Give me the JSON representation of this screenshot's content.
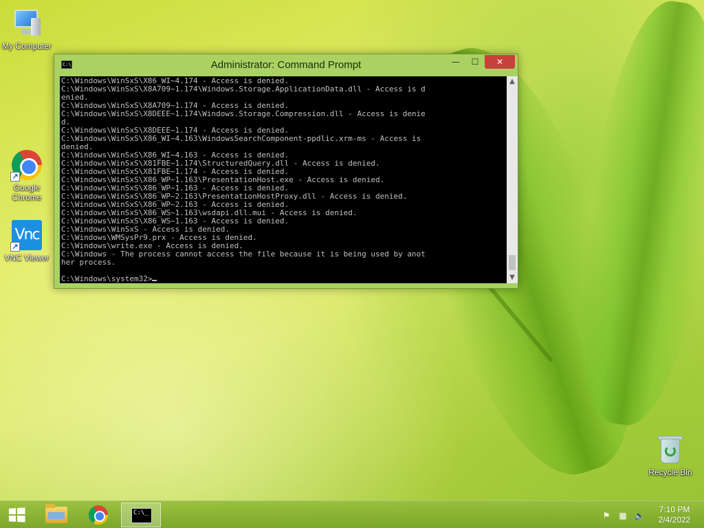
{
  "desktop": {
    "icons": [
      {
        "label": "My Computer"
      },
      {
        "label": "Google Chrome"
      },
      {
        "label": "VNC Viewer"
      },
      {
        "label": "Recycle Bin"
      }
    ],
    "vnc_glyph": "Vnc",
    "shortcut_glyph": "↗"
  },
  "window": {
    "title": "Administrator: Command Prompt",
    "icon_text": "C:\\",
    "minimize_glyph": "—",
    "maximize_glyph": "☐",
    "close_glyph": "✕"
  },
  "console": {
    "lines": [
      "C:\\Windows\\WinSxS\\X86_WI~4.174 - Access is denied.",
      "C:\\Windows\\WinSxS\\X8A709~1.174\\Windows.Storage.ApplicationData.dll - Access is d",
      "enied.",
      "C:\\Windows\\WinSxS\\X8A709~1.174 - Access is denied.",
      "C:\\Windows\\WinSxS\\X8DEEE~1.174\\Windows.Storage.Compression.dll - Access is denie",
      "d.",
      "C:\\Windows\\WinSxS\\X8DEEE~1.174 - Access is denied.",
      "C:\\Windows\\WinSxS\\X86_WI~4.163\\WindowsSearchComponent-ppdlic.xrm-ms - Access is",
      "denied.",
      "C:\\Windows\\WinSxS\\X86_WI~4.163 - Access is denied.",
      "C:\\Windows\\WinSxS\\X81FBE~1.174\\StructuredQuery.dll - Access is denied.",
      "C:\\Windows\\WinSxS\\X81FBE~1.174 - Access is denied.",
      "C:\\Windows\\WinSxS\\X86_WP~1.163\\PresentationHost.exe - Access is denied.",
      "C:\\Windows\\WinSxS\\X86_WP~1.163 - Access is denied.",
      "C:\\Windows\\WinSxS\\X86_WP~2.163\\PresentationHostProxy.dll - Access is denied.",
      "C:\\Windows\\WinSxS\\X86_WP~2.163 - Access is denied.",
      "C:\\Windows\\WinSxS\\X86_WS~1.163\\wsdapi.dll.mui - Access is denied.",
      "C:\\Windows\\WinSxS\\X86_WS~1.163 - Access is denied.",
      "C:\\Windows\\WinSxS - Access is denied.",
      "C:\\Windows\\WMSysPr9.prx - Access is denied.",
      "C:\\Windows\\write.exe - Access is denied.",
      "C:\\Windows - The process cannot access the file because it is being used by anot",
      "her process.",
      "",
      "C:\\Windows\\system32>"
    ]
  },
  "scrollbar": {
    "up_glyph": "▲",
    "down_glyph": "▼"
  },
  "tray": {
    "flag_glyph": "⚑",
    "network_glyph": "▦",
    "volume_glyph": "🔈",
    "time": "7:10 PM",
    "date": "2/4/2022"
  },
  "taskbar": {
    "cmd_icon_text": "C:\\_"
  }
}
